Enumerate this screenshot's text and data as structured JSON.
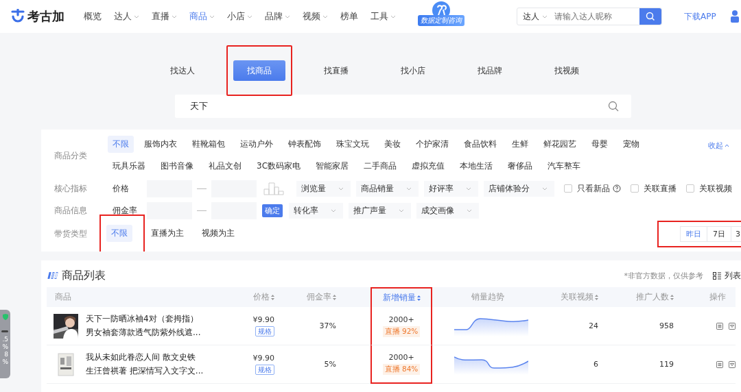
{
  "header": {
    "logo": "考古加",
    "nav": [
      {
        "label": "概览",
        "selected": false,
        "dropdown": false
      },
      {
        "label": "达人",
        "selected": false,
        "dropdown": true
      },
      {
        "label": "直播",
        "selected": false,
        "dropdown": true
      },
      {
        "label": "商品",
        "selected": true,
        "dropdown": true
      },
      {
        "label": "小店",
        "selected": false,
        "dropdown": true
      },
      {
        "label": "品牌",
        "selected": false,
        "dropdown": true
      },
      {
        "label": "视频",
        "selected": false,
        "dropdown": true
      },
      {
        "label": "榜单",
        "selected": false,
        "dropdown": false
      },
      {
        "label": "工具",
        "selected": false,
        "dropdown": true
      }
    ],
    "promo_badge": "数据定制咨询",
    "search_scope": "达人",
    "search_placeholder": "请输入达人昵称",
    "download": "下载APP"
  },
  "search_tabs": [
    {
      "label": "找达人",
      "selected": false,
      "highlighted": false
    },
    {
      "label": "找商品",
      "selected": true,
      "highlighted": true
    },
    {
      "label": "找直播",
      "selected": false,
      "highlighted": false
    },
    {
      "label": "找小店",
      "selected": false,
      "highlighted": false
    },
    {
      "label": "找品牌",
      "selected": false,
      "highlighted": false
    },
    {
      "label": "找视频",
      "selected": false,
      "highlighted": false
    }
  ],
  "search": {
    "value": "天下"
  },
  "filters": {
    "category": {
      "label": "商品分类",
      "collapse": "收起",
      "options": [
        {
          "label": "不限",
          "selected": true
        },
        {
          "label": "服饰内衣",
          "selected": false
        },
        {
          "label": "鞋靴箱包",
          "selected": false
        },
        {
          "label": "运动户外",
          "selected": false
        },
        {
          "label": "钟表配饰",
          "selected": false
        },
        {
          "label": "珠宝文玩",
          "selected": false
        },
        {
          "label": "美妆",
          "selected": false
        },
        {
          "label": "个护家清",
          "selected": false
        },
        {
          "label": "食品饮料",
          "selected": false
        },
        {
          "label": "生鲜",
          "selected": false
        },
        {
          "label": "鲜花园艺",
          "selected": false
        },
        {
          "label": "母婴",
          "selected": false
        },
        {
          "label": "宠物",
          "selected": false
        },
        {
          "label": "玩具乐器",
          "selected": false
        },
        {
          "label": "图书音像",
          "selected": false
        },
        {
          "label": "礼品文创",
          "selected": false
        },
        {
          "label": "3C数码家电",
          "selected": false
        },
        {
          "label": "智能家居",
          "selected": false
        },
        {
          "label": "二手商品",
          "selected": false
        },
        {
          "label": "虚拟充值",
          "selected": false
        },
        {
          "label": "本地生活",
          "selected": false
        },
        {
          "label": "奢侈品",
          "selected": false
        },
        {
          "label": "汽车整车",
          "selected": false
        }
      ]
    },
    "core": {
      "label": "核心指标",
      "range_label": "价格",
      "dropdowns": [
        "浏览量",
        "商品销量",
        "好评率",
        "店铺体验分"
      ],
      "checks": [
        {
          "label": "只看新品",
          "checked": false,
          "help": true
        },
        {
          "label": "关联直播",
          "checked": false,
          "help": false
        },
        {
          "label": "关联视频",
          "checked": false,
          "help": false
        }
      ]
    },
    "info": {
      "label": "商品信息",
      "range_label": "佣金率",
      "confirm": "确定",
      "dropdowns": [
        "转化率",
        "推广声量",
        "成交画像"
      ]
    },
    "type": {
      "label": "带货类型",
      "options": [
        {
          "label": "不限",
          "selected": true,
          "highlighted": true
        },
        {
          "label": "直播为主",
          "selected": false,
          "highlighted": false
        },
        {
          "label": "视频为主",
          "selected": false,
          "highlighted": false
        }
      ],
      "periods_highlighted": true,
      "periods": [
        {
          "label": "昨日",
          "selected": true
        },
        {
          "label": "7日",
          "selected": false
        },
        {
          "label": "3",
          "selected": false
        }
      ]
    }
  },
  "side_widget": {
    "lines": [
      ".5",
      "%",
      "8",
      "%"
    ]
  },
  "list": {
    "title": "商品列表",
    "note": "*非官方数据，仅供参考",
    "view": "列表",
    "columns": [
      {
        "label": "商品",
        "sortable": false,
        "selected": false,
        "highlighted": false
      },
      {
        "label": "价格",
        "sortable": true,
        "selected": false,
        "highlighted": false
      },
      {
        "label": "佣金率",
        "sortable": true,
        "selected": false,
        "highlighted": false
      },
      {
        "label": "新增销量",
        "sortable": true,
        "selected": true,
        "highlighted": true
      },
      {
        "label": "销量趋势",
        "sortable": false,
        "selected": false,
        "highlighted": false
      },
      {
        "label": "关联视频",
        "sortable": true,
        "selected": false,
        "highlighted": false
      },
      {
        "label": "推广人数",
        "sortable": true,
        "selected": false,
        "highlighted": false
      },
      {
        "label": "操作",
        "sortable": false,
        "selected": false,
        "highlighted": false
      }
    ],
    "rows": [
      {
        "title": "天下一防晒冰袖4对（套拇指）",
        "subtitle": "男女袖套薄款透气防紫外线遮...",
        "price": "¥9.90",
        "spec": "规格",
        "commission": "37%",
        "sales": "2000+",
        "sales_tag": "直播 92%",
        "videos": "24",
        "promoters": "958"
      },
      {
        "title": "我从未如此眷恋人间 散文史铁",
        "subtitle": "生汪曾祺著 把深情写入文字文...",
        "price": "¥9.90",
        "spec": "规格",
        "commission": "5%",
        "sales": "2000+",
        "sales_tag": "直播 84%",
        "videos": "6",
        "promoters": "119"
      }
    ]
  }
}
